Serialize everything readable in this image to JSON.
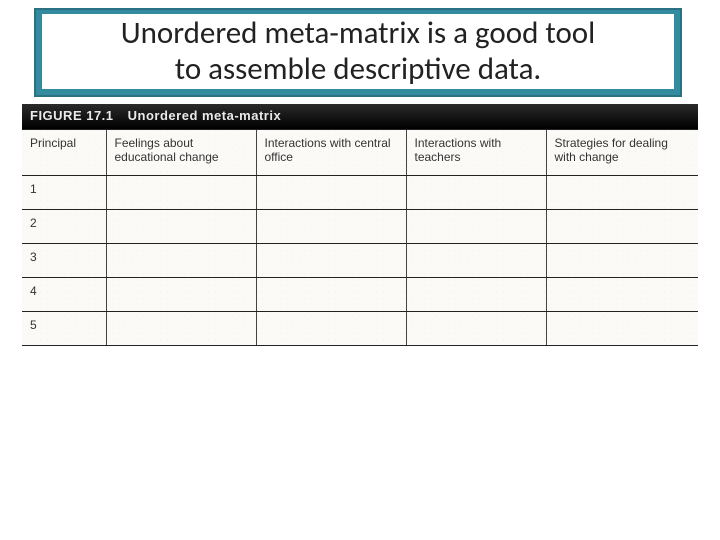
{
  "title": {
    "line1": "Unordered meta-matrix is a good tool",
    "line2": "to assemble descriptive data."
  },
  "figure": {
    "label": "FIGURE 17.1",
    "caption": "Unordered meta-matrix"
  },
  "columns": {
    "c0": "Principal",
    "c1": "Feelings about educational change",
    "c2": "Interactions with central office",
    "c3": "Interactions with teachers",
    "c4": "Strategies for dealing with change"
  },
  "rows": {
    "r0": "1",
    "r1": "2",
    "r2": "3",
    "r3": "4",
    "r4": "5"
  }
}
